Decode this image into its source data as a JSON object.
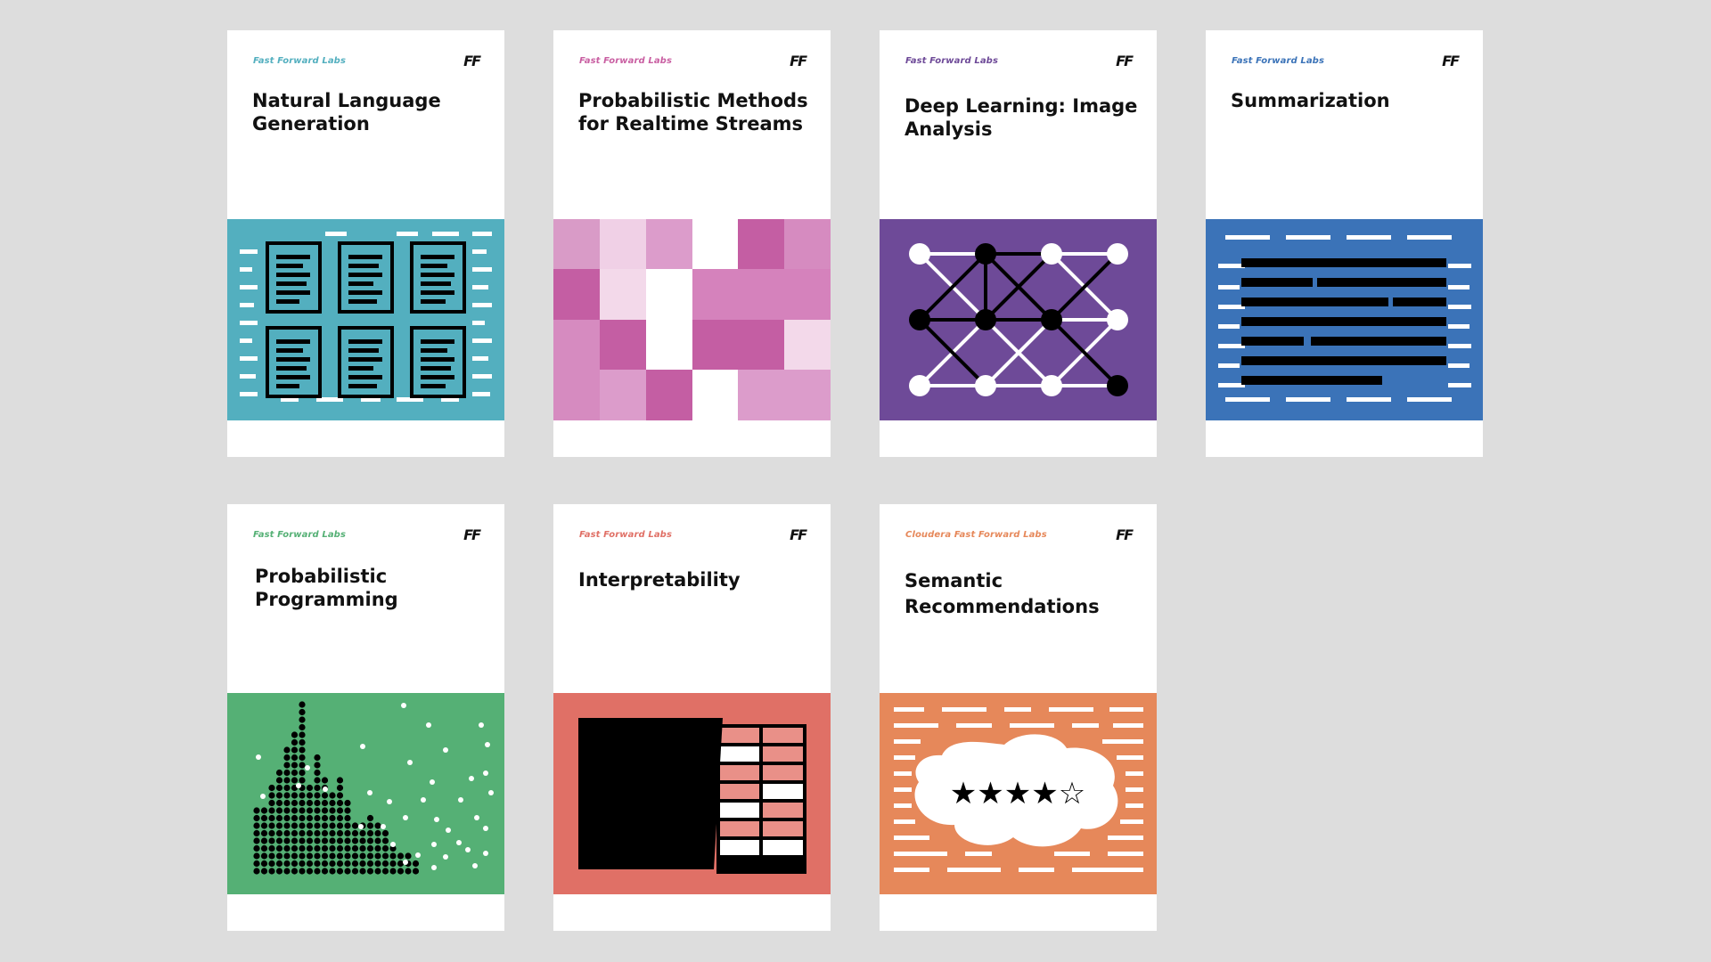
{
  "cards": [
    {
      "brand": "Fast Forward Labs",
      "logo": "FF",
      "title": "Natural Language Generation",
      "accent": "#53afbf",
      "icon": "documents-grid-icon"
    },
    {
      "brand": "Fast Forward Labs",
      "logo": "FF",
      "title": "Probabilistic Methods for Realtime Streams",
      "accent": "#c95fa2",
      "icon": "pink-mosaic-icon"
    },
    {
      "brand": "Fast Forward Labs",
      "logo": "FF",
      "title": "Deep Learning: Image Analysis",
      "accent": "#6e4a98",
      "icon": "neural-network-icon"
    },
    {
      "brand": "Fast Forward Labs",
      "logo": "FF",
      "title": "Summarization",
      "accent": "#3b73b8",
      "icon": "redacted-text-icon"
    },
    {
      "brand": "Fast Forward Labs",
      "logo": "FF",
      "title": "Probabilistic Programming",
      "accent": "#55b075",
      "icon": "dot-histogram-icon"
    },
    {
      "brand": "Fast Forward Labs",
      "logo": "FF",
      "title": "Interpretability",
      "accent": "#e07066",
      "icon": "black-box-table-icon"
    },
    {
      "brand": "Cloudera Fast Forward Labs",
      "logo": "FF",
      "title": "Semantic Recommendations",
      "accent": "#e6885a",
      "icon": "star-rating-cloud-icon",
      "rating": "★★★★☆"
    }
  ]
}
